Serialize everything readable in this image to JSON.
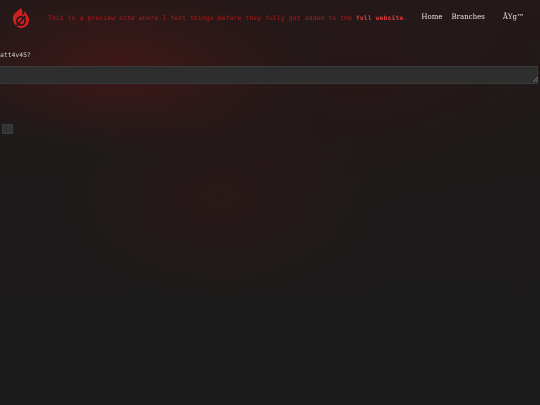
{
  "header": {
    "logo_icon": "flame-logo-icon",
    "notice_text": "This is a preview site where I test things before they fully get added to the ",
    "notice_link": "full website",
    "notice_end": ".",
    "nav": {
      "home": "Home",
      "branches": "Branches",
      "language": "ÅYg™"
    }
  },
  "main": {
    "field_label": "att4v45?",
    "input_value": "",
    "input_placeholder": ""
  },
  "colors": {
    "accent_red": "#e0383a",
    "notice_red": "#b01a1a",
    "background": "#1b1b1b"
  }
}
